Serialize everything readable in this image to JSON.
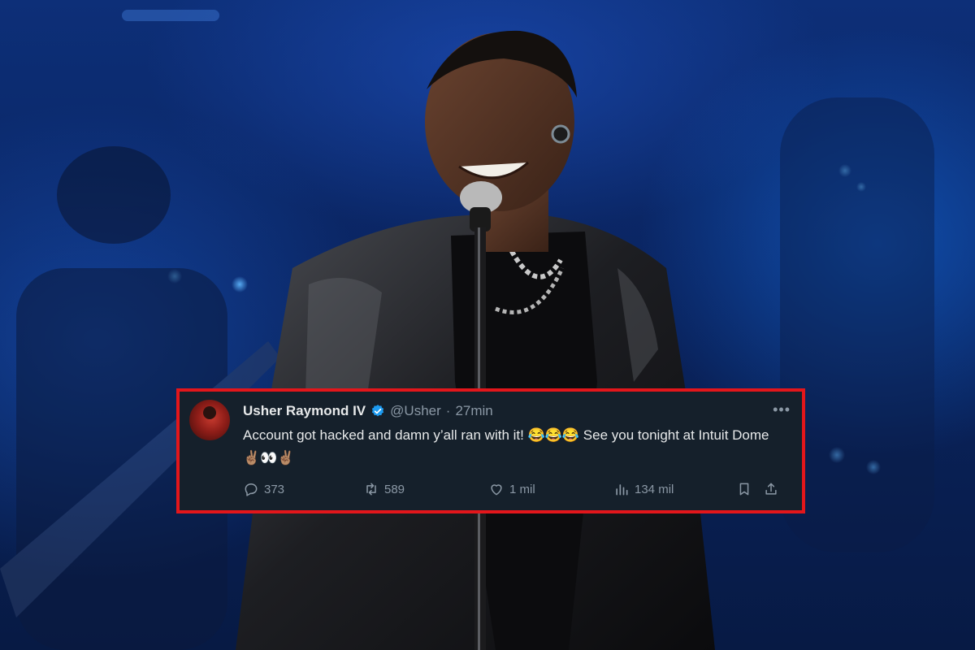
{
  "tweet": {
    "display_name": "Usher Raymond IV",
    "handle": "@Usher",
    "separator": "·",
    "time": "27min",
    "text": "Account got hacked and damn y’all ran with it! 😂😂😂 See you tonight at Intuit Dome ✌🏽👀✌🏽",
    "stats": {
      "replies": "373",
      "retweets": "589",
      "likes": "1 mil",
      "views": "134 mil"
    }
  },
  "colors": {
    "frame": "#e3161b",
    "card_bg": "#15202b",
    "text": "#e7e9ea",
    "muted": "#8b98a5",
    "verified": "#1d9bf0"
  },
  "icons": [
    "verified-badge-icon",
    "more-options-icon",
    "reply-icon",
    "retweet-icon",
    "like-icon",
    "views-icon",
    "bookmark-icon",
    "share-icon"
  ]
}
